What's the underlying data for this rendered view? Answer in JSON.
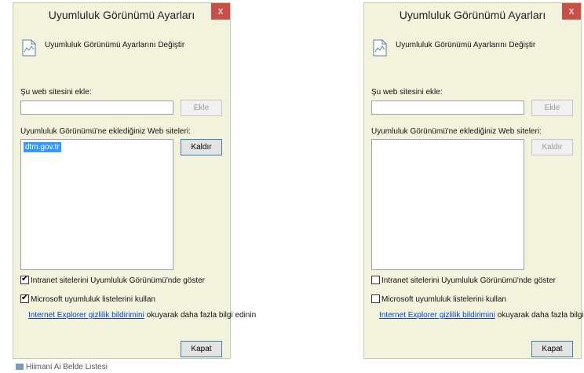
{
  "dialogs": [
    {
      "title": "Uyumluluk Görünümü Ayarları",
      "close_glyph": "x",
      "header_icon": "document-icon",
      "header_text": "Uyumluluk Görünümü Ayarlarını Değiştir",
      "add_label": "Şu web sitesini ekle:",
      "add_input_value": "",
      "add_button": "Ekle",
      "list_label": "Uyumluluk Görünümü'ne eklediğiniz Web siteleri:",
      "list_items": [
        "dtm.gov.tr"
      ],
      "remove_button": "Kaldır",
      "intranet_label": "Intranet sitelerini Uyumluluk Görünümü'nde göster",
      "intranet_checked": true,
      "ms_lists_label": "Microsoft uyumluluk listelerini kullan",
      "ms_lists_checked": true,
      "privacy_link": "Internet Explorer gizlilik bildirimini",
      "privacy_suffix": " okuyarak daha fazla bilgi edinin",
      "close_button": "Kapat"
    },
    {
      "title": "Uyumluluk Görünümü Ayarları",
      "close_glyph": "x",
      "header_icon": "document-icon",
      "header_text": "Uyumluluk Görünümü Ayarlarını Değiştir",
      "add_label": "Şu web sitesini ekle:",
      "add_input_value": "",
      "add_button": "Ekle",
      "list_label": "Uyumluluk Görünümü'ne eklediğiniz Web siteleri:",
      "list_items": [],
      "remove_button": "Kaldır",
      "intranet_label": "Intranet sitelerini Uyumluluk Görünümü'nde göster",
      "intranet_checked": false,
      "ms_lists_label": "Microsoft uyumluluk listelerini kullan",
      "ms_lists_checked": false,
      "privacy_link": "Internet Explorer gizlilik bildirimini",
      "privacy_suffix": " okuyarak daha fazla bilgi edinin",
      "close_button": "Kapat"
    }
  ],
  "background_fragment": "Hiimani Ai Belde Listesi",
  "colors": {
    "dialog_bg": "#f3f3dd",
    "close_button": "#c7504a",
    "selection": "#3399ff",
    "link": "#0645c4"
  }
}
